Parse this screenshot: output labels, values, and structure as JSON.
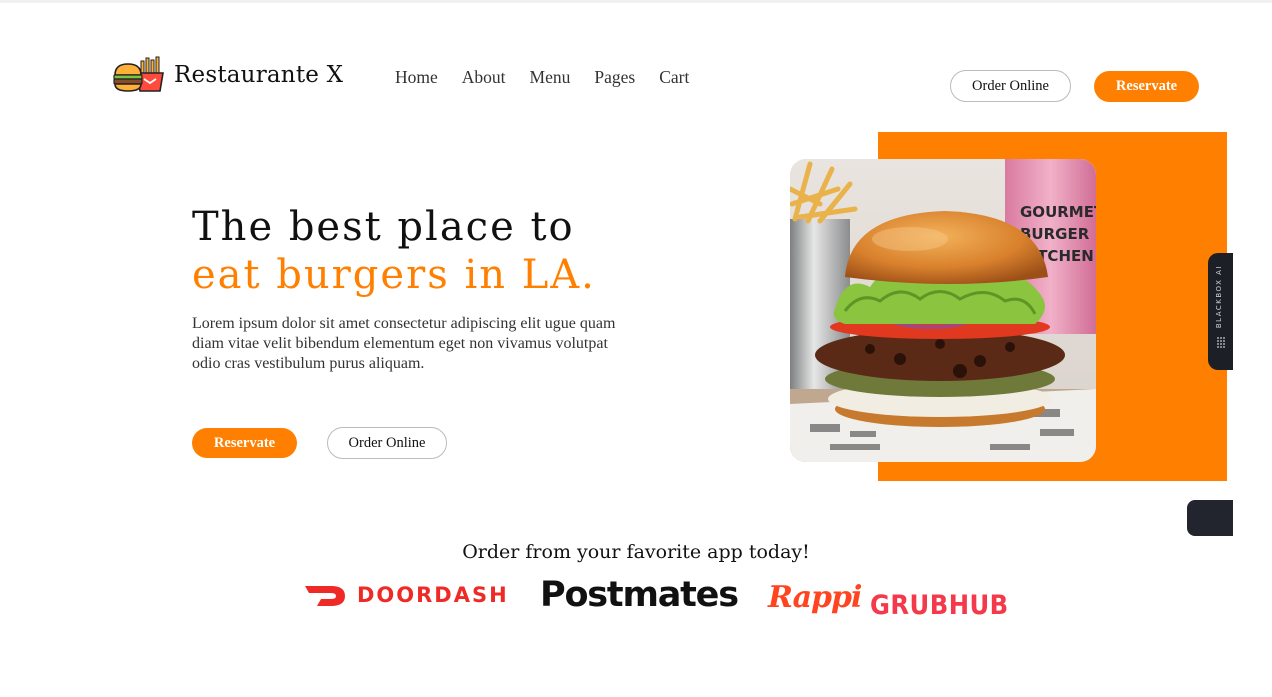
{
  "header": {
    "brand": "Restaurante X",
    "nav": [
      "Home",
      "About",
      "Menu",
      "Pages",
      "Cart"
    ],
    "order_online_label": "Order Online",
    "reservate_label": "Reservate"
  },
  "hero": {
    "title_line1": "The best place to",
    "title_line2": "eat burgers in LA.",
    "description": "Lorem ipsum dolor sit amet consectetur adipiscing elit ugue quam diam vitae velit bibendum elementum eget non vivamus volutpat odio cras vestibulum purus aliquam.",
    "reservate_label": "Reservate",
    "order_online_label": "Order Online",
    "image_sign_text": "GOURMET BURGER KITCHEN"
  },
  "side_widget": {
    "label": "BLACKBOX AI"
  },
  "apps": {
    "title": "Order from your favorite app today!",
    "doordash": "DOORDASH",
    "postmates": "Postmates",
    "rappi": "Rappi",
    "grubhub": "GRUBHUB"
  },
  "colors": {
    "accent": "#ff8000",
    "dark": "#111111",
    "doordash": "#ef2a26",
    "grubhub": "#f43a4a",
    "rappi": "#ff441f"
  },
  "icons": [
    "burger-fries-logo-icon",
    "doordash-logo-icon",
    "blackbox-dots-icon"
  ]
}
